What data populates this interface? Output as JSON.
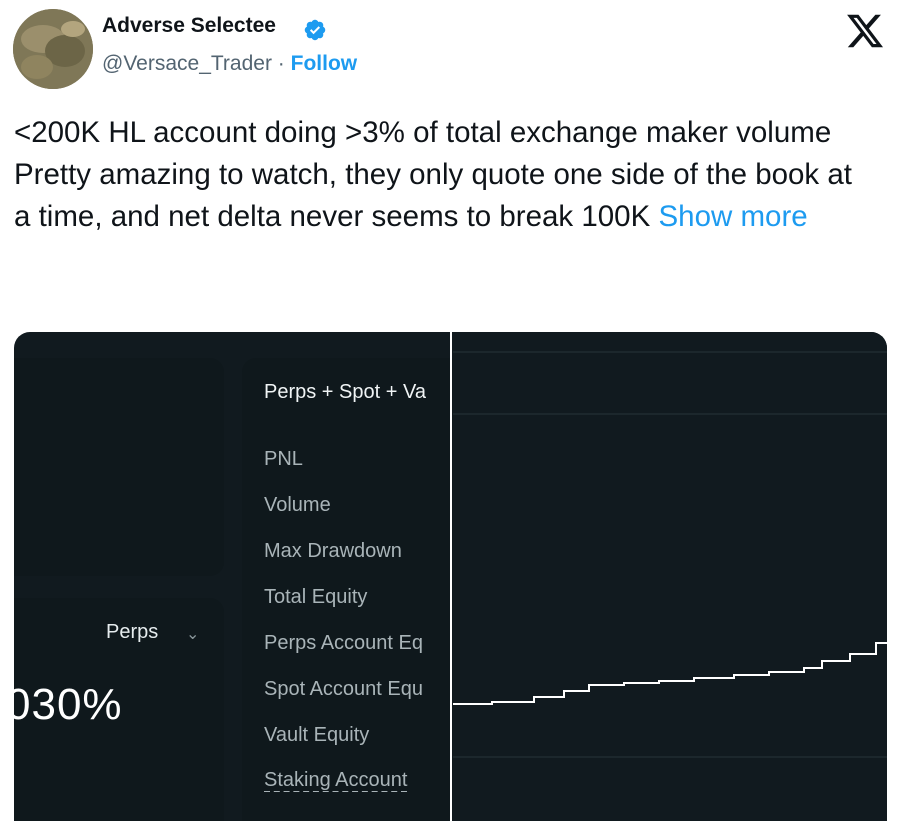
{
  "author": {
    "name": "Adverse Selectee",
    "handle": "@Versace_Trader",
    "separator": "·",
    "follow_label": "Follow",
    "verified_icon": "verified-badge-icon",
    "brand_logo": "x-logo-icon"
  },
  "tweet": {
    "text": "<200K HL account doing >3% of total exchange maker volume\nPretty amazing to watch, they only quote one side of the book at a time, and net delta never seems to break 100K",
    "show_more": "Show more"
  },
  "screenshot": {
    "dropdown_label": "Perps",
    "percent_value": "030%",
    "tab_title": "Perps + Spot + Va",
    "menu_items": [
      "PNL",
      "Volume",
      "Max Drawdown",
      "Total Equity",
      "Perps Account Eq",
      "Spot Account Equ",
      "Vault Equity",
      "Staking Account"
    ]
  },
  "colors": {
    "link": "#1d9bf0",
    "text": "#0f1419",
    "muted": "#536471",
    "panel_bg": "#0f181c",
    "media_bg": "#111a1f"
  }
}
